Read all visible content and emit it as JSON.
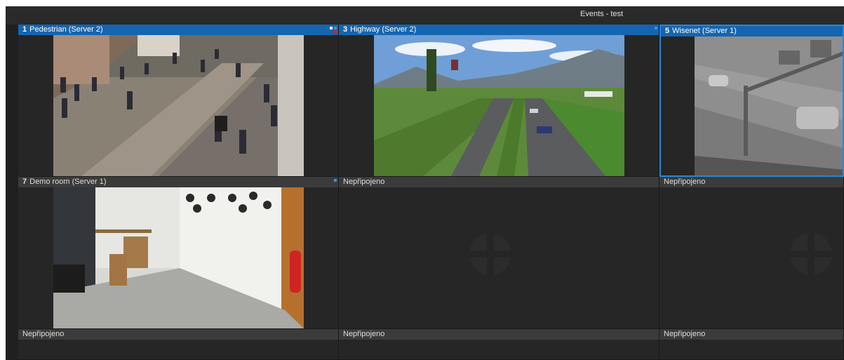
{
  "window": {
    "title": "Events - test"
  },
  "tiles": [
    {
      "number": "1",
      "camera": "Pedestrian (Server 2)"
    },
    {
      "number": "3",
      "camera": "Highway (Server 2)"
    },
    {
      "number": "5",
      "camera": "Wisenet (Server 1)"
    },
    {
      "number": "7",
      "camera": "Demo room (Server 1)"
    }
  ],
  "empty_label": "Nepřipojeno",
  "colors": {
    "selected_header": "#1565b0",
    "indicator": "#2a9ae8",
    "alert": "#e02020"
  },
  "icons": {
    "placeholder": "camera-placeholder-logo"
  }
}
